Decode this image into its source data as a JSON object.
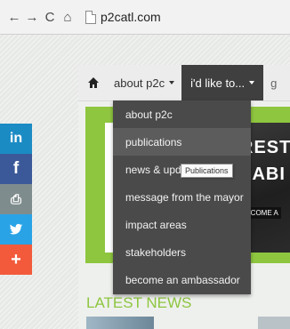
{
  "browser": {
    "back_glyph": "←",
    "forward_glyph": "→",
    "reload_glyph": "C",
    "home_glyph": "⌂",
    "url": "p2catl.com"
  },
  "nav": {
    "about_label": "about p2c",
    "like_label": "i'd like to...",
    "partial_label": "g"
  },
  "dropdown": {
    "items": [
      "about p2c",
      "publications",
      "news & upda",
      "message from the mayor",
      "impact areas",
      "stakeholders",
      "become an ambassador"
    ],
    "hovered_index": 1
  },
  "tooltip": "Publications",
  "banner": {
    "line1": "REST",
    "line2": "NABI",
    "cta": "BECOME A"
  },
  "latest_news": "LATEST NEWS",
  "social": {
    "linkedin": "in",
    "facebook": "f",
    "print": "⎙",
    "twitter": "♥",
    "plus": "+"
  },
  "colors": {
    "accent_green": "#8ec63f",
    "dropdown_bg": "#4a4a4a",
    "nav_active_bg": "#3f3f3f",
    "linkedin": "#1b8bc4",
    "facebook": "#3b5998",
    "print": "#7f8c8d",
    "twitter": "#2aa3e6",
    "plus": "#f25a3b"
  }
}
